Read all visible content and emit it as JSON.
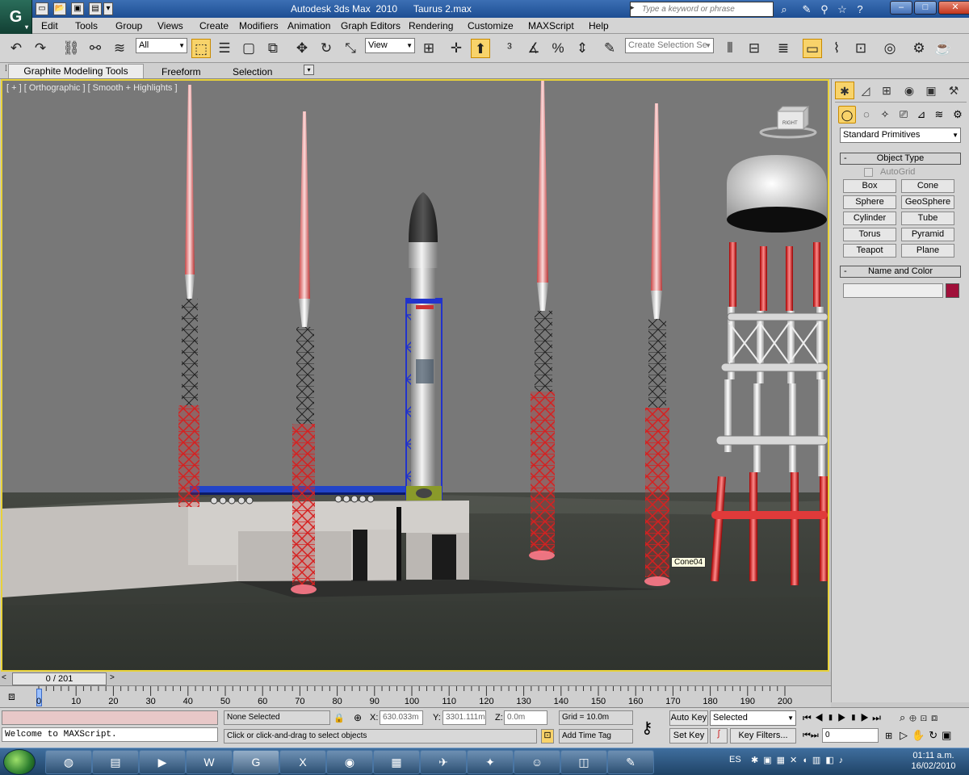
{
  "window": {
    "title": "Autodesk 3ds Max  2010      Taurus 2.max",
    "search_placeholder": "Type a keyword or phrase"
  },
  "menu": [
    "Edit",
    "Tools",
    "Group",
    "Views",
    "Create",
    "Modifiers",
    "Animation",
    "Graph Editors",
    "Rendering",
    "Customize",
    "MAXScript",
    "Help"
  ],
  "toolbar": {
    "filter_value": "All",
    "ref_coord_value": "View",
    "named_selection_placeholder": "Create Selection Se"
  },
  "ribbon": {
    "tabs": [
      "Graphite Modeling Tools",
      "Freeform",
      "Selection"
    ]
  },
  "viewport": {
    "label": "[ + ] [ Orthographic ] [ Smooth + Highlights ]",
    "viewcube_face": "RIGHT",
    "tooltip": "Cone04"
  },
  "command_panel": {
    "category_value": "Standard Primitives",
    "object_type_title": "Object Type",
    "autogrid_label": "AutoGrid",
    "buttons": [
      "Box",
      "Cone",
      "Sphere",
      "GeoSphere",
      "Cylinder",
      "Tube",
      "Torus",
      "Pyramid",
      "Teapot",
      "Plane"
    ],
    "name_color_title": "Name and Color",
    "object_color": "#a0103a"
  },
  "timeline": {
    "frame_counter": "0 / 201",
    "ticks": [
      "0",
      "10",
      "20",
      "30",
      "40",
      "50",
      "60",
      "70",
      "80",
      "90",
      "100",
      "110",
      "120",
      "130",
      "140",
      "150",
      "160",
      "170",
      "180",
      "190",
      "200"
    ]
  },
  "status": {
    "maxscript_output": "Welcome to MAXScript.",
    "selection_status": "None Selected",
    "prompt": "Click or click-and-drag to select objects",
    "x_label": "X:",
    "x_value": "630.033m",
    "y_label": "Y:",
    "y_value": "3301.111m",
    "z_label": "Z:",
    "z_value": "0.0m",
    "grid": "Grid = 10.0m",
    "add_time_tag": "Add Time Tag",
    "auto_key": "Auto Key",
    "set_key": "Set Key",
    "key_mode_value": "Selected",
    "key_filters": "Key Filters...",
    "current_frame": "0"
  },
  "taskbar": {
    "language": "ES",
    "time": "01:11 a.m.",
    "date": "16/02/2010"
  }
}
